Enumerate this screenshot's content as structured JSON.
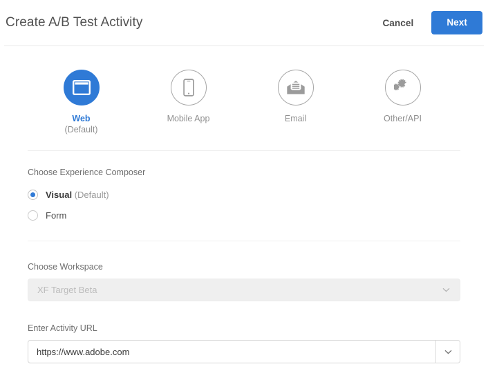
{
  "header": {
    "title": "Create A/B Test Activity",
    "cancel_label": "Cancel",
    "next_label": "Next",
    "accent_color": "#2f7ad6"
  },
  "channels": [
    {
      "label": "Web",
      "sublabel": "(Default)",
      "icon": "browser-window-icon",
      "selected": true
    },
    {
      "label": "Mobile App",
      "sublabel": "",
      "icon": "mobile-phone-icon",
      "selected": false
    },
    {
      "label": "Email",
      "sublabel": "",
      "icon": "envelope-icon",
      "selected": false
    },
    {
      "label": "Other/API",
      "sublabel": "",
      "icon": "gears-icon",
      "selected": false
    }
  ],
  "composer": {
    "label": "Choose Experience Composer",
    "options": [
      {
        "label": "Visual",
        "suffix": "(Default)",
        "checked": true
      },
      {
        "label": "Form",
        "suffix": "",
        "checked": false
      }
    ]
  },
  "workspace": {
    "label": "Choose Workspace",
    "value": "XF Target Beta",
    "disabled": true,
    "chevron_icon": "chevron-down-icon"
  },
  "activity_url": {
    "label": "Enter Activity URL",
    "value": "https://www.adobe.com",
    "placeholder": "",
    "chevron_icon": "chevron-down-icon"
  }
}
